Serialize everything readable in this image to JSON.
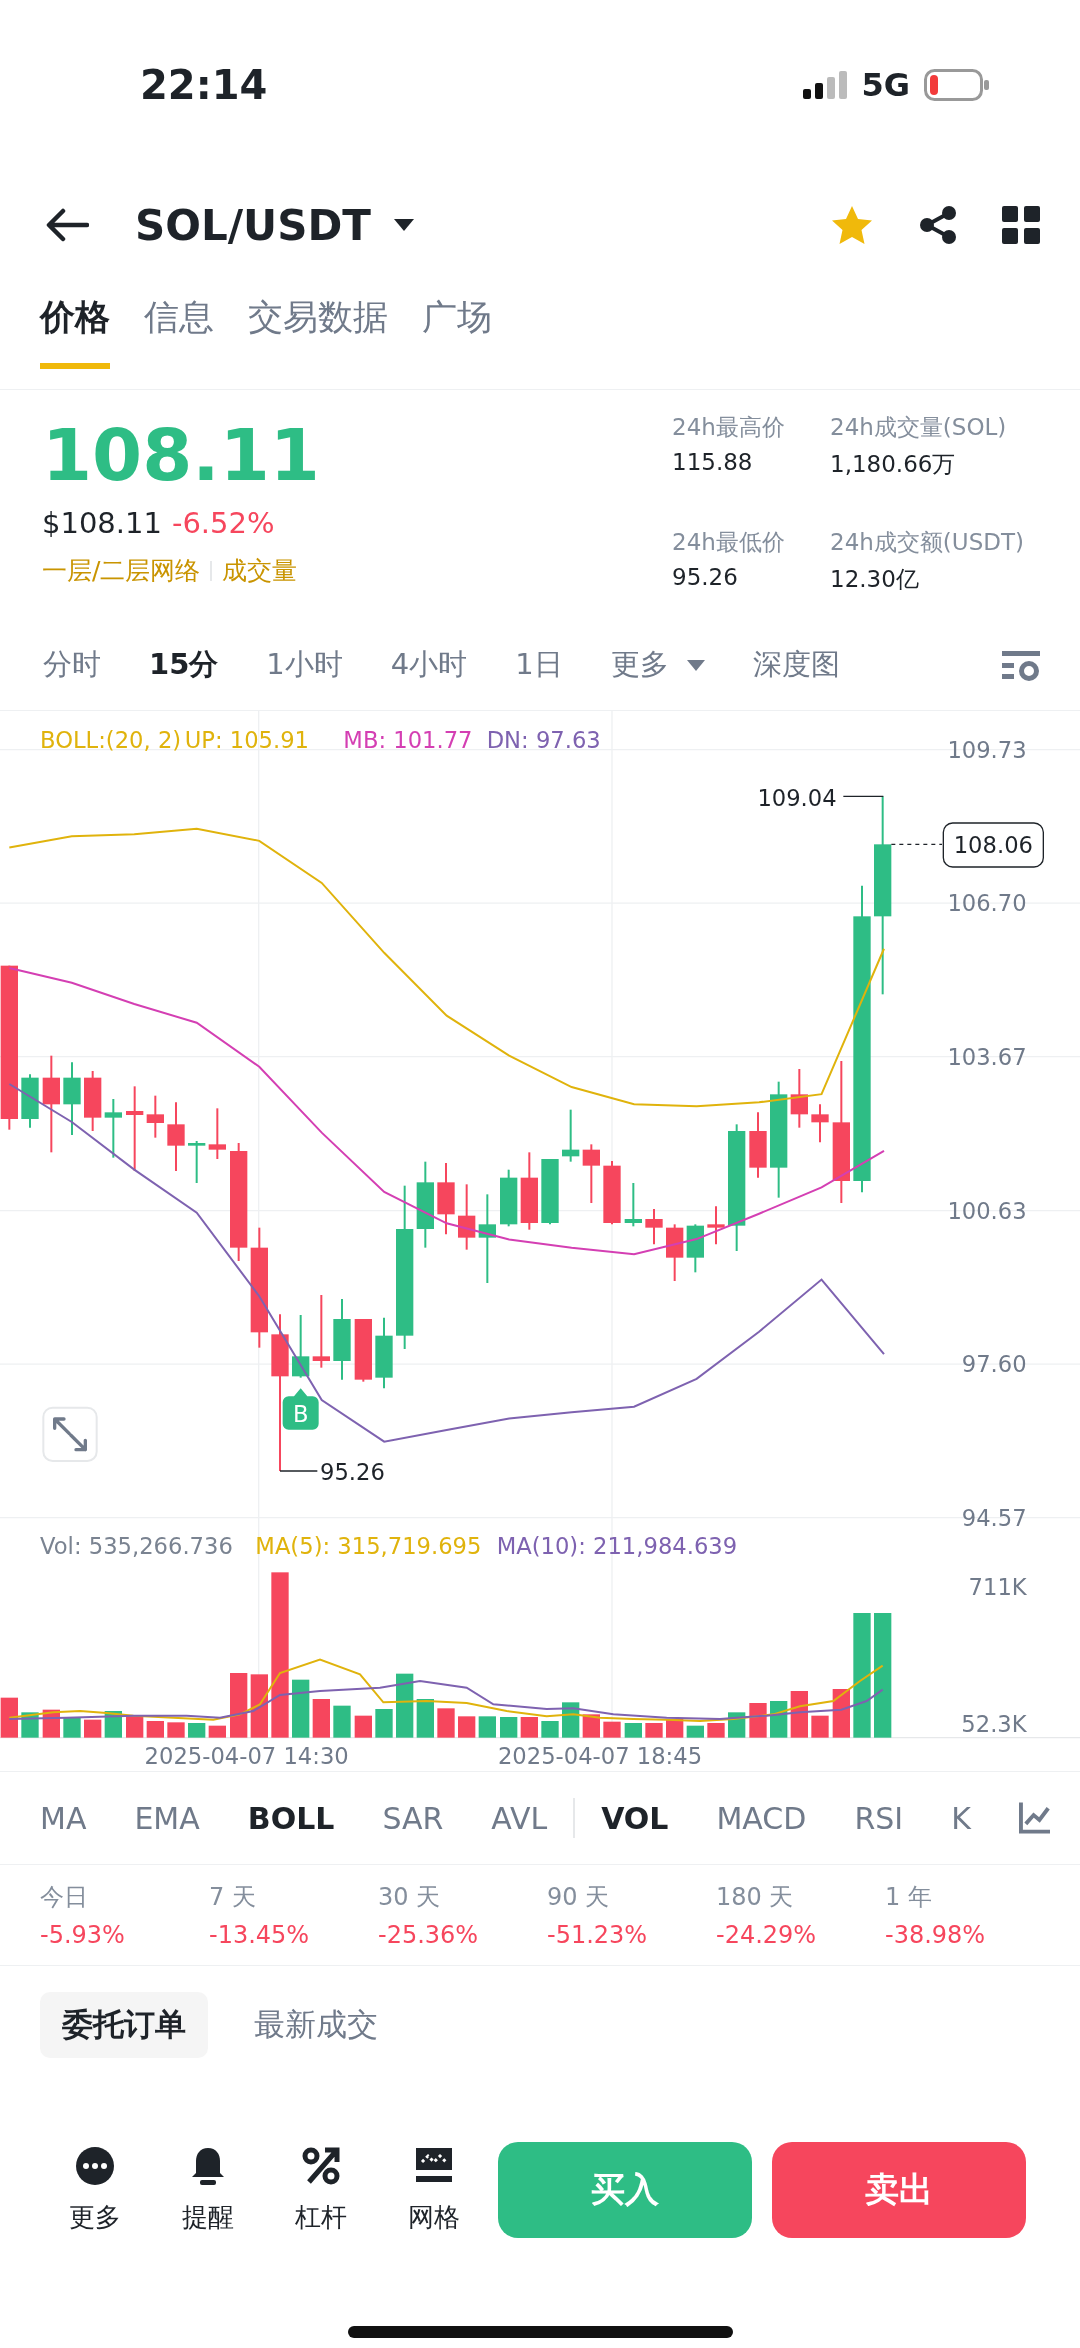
{
  "status_bar": {
    "time": "22:14",
    "network": "5G"
  },
  "header": {
    "title": "SOL/USDT",
    "favorite": true
  },
  "tabs": [
    {
      "label": "价格",
      "selected": true
    },
    {
      "label": "信息",
      "selected": false
    },
    {
      "label": "交易数据",
      "selected": false
    },
    {
      "label": "广场",
      "selected": false
    }
  ],
  "price": {
    "last": "108.11",
    "usd": "$108.11",
    "change": "-6.52%",
    "tags": [
      "一层/二层网络",
      "成交量"
    ]
  },
  "stats": [
    {
      "label": "24h最高价",
      "value": "115.88"
    },
    {
      "label": "24h成交量(SOL)",
      "value": "1,180.66万"
    },
    {
      "label": "24h最低价",
      "value": "95.26"
    },
    {
      "label": "24h成交额(USDT)",
      "value": "12.30亿"
    }
  ],
  "intervals": [
    {
      "label": "分时",
      "kind": "option",
      "selected": false
    },
    {
      "label": "15分",
      "kind": "option",
      "selected": true
    },
    {
      "label": "1小时",
      "kind": "option",
      "selected": false
    },
    {
      "label": "4小时",
      "kind": "option",
      "selected": false
    },
    {
      "label": "1日",
      "kind": "option",
      "selected": false
    },
    {
      "label": "更多",
      "kind": "dropdown",
      "selected": false
    },
    {
      "label": "深度图",
      "kind": "option",
      "selected": false
    }
  ],
  "chart": {
    "legend": [
      {
        "text": "BOLL:(20, 2)",
        "color": "#e0b30c"
      },
      {
        "text": "UP: 105.91",
        "color": "#e0b30c"
      },
      {
        "text": "MB: 101.77",
        "color": "#d43fb3"
      },
      {
        "text": "DN: 97.63",
        "color": "#7e62b0"
      }
    ],
    "chart_data": {
      "type": "line",
      "ylim": [
        94.57,
        109.73
      ],
      "grid": true,
      "yticks": [
        {
          "value": 109.73,
          "label": "109.73"
        },
        {
          "value": 106.7,
          "label": "106.70"
        },
        {
          "value": 103.67,
          "label": "103.67"
        },
        {
          "value": 100.63,
          "label": "100.63"
        },
        {
          "value": 97.6,
          "label": "97.60"
        },
        {
          "value": 94.57,
          "label": "94.57"
        }
      ],
      "series": [
        {
          "color": "#e0b30c",
          "values": [
            107.8,
            108.02,
            108.06,
            108.17,
            107.93,
            107.1,
            105.72,
            104.48,
            103.69,
            103.07,
            102.73,
            102.69,
            102.77,
            102.93,
            105.8
          ]
        },
        {
          "color": "#d43fb3",
          "values": [
            105.42,
            105.13,
            104.71,
            104.34,
            103.47,
            102.17,
            101.0,
            100.38,
            100.06,
            99.9,
            99.77,
            100.07,
            100.57,
            101.09,
            101.81
          ]
        },
        {
          "color": "#7e62b0",
          "values": [
            103.13,
            102.38,
            101.44,
            100.59,
            98.94,
            96.89,
            96.07,
            96.3,
            96.53,
            96.65,
            96.76,
            97.31,
            98.24,
            99.27,
            97.8
          ]
        }
      ]
    },
    "high_label": "109.04",
    "low_label": "95.26",
    "current_price": "108.06",
    "marker": "B",
    "volume_legend": [
      {
        "text": "Vol: 535,266.736",
        "color": "#7a8391"
      },
      {
        "text": "MA(5): 315,719.695",
        "color": "#e0b30c"
      },
      {
        "text": "MA(10): 211,984.639",
        "color": "#7e62b0"
      }
    ],
    "volume_ticks": [
      "711K",
      "52.3K"
    ],
    "time_labels": [
      "2025-04-07 14:30",
      "2025-04-07 18:45"
    ]
  },
  "main_indicators": [
    {
      "label": "MA",
      "selected": false
    },
    {
      "label": "EMA",
      "selected": false
    },
    {
      "label": "BOLL",
      "selected": true
    },
    {
      "label": "SAR",
      "selected": false
    },
    {
      "label": "AVL",
      "selected": false
    }
  ],
  "sub_indicators": [
    {
      "label": "VOL",
      "selected": true
    },
    {
      "label": "MACD",
      "selected": false
    },
    {
      "label": "RSI",
      "selected": false
    },
    {
      "label": "K",
      "selected": false
    }
  ],
  "performance": [
    {
      "period": "今日",
      "change": "-5.93%"
    },
    {
      "period": "7 天",
      "change": "-13.45%"
    },
    {
      "period": "30 天",
      "change": "-25.36%"
    },
    {
      "period": "90 天",
      "change": "-51.23%"
    },
    {
      "period": "180 天",
      "change": "-24.29%"
    },
    {
      "period": "1 年",
      "change": "-38.98%"
    }
  ],
  "order_tabs": [
    {
      "label": "委托订单",
      "selected": true
    },
    {
      "label": "最新成交",
      "selected": false
    }
  ],
  "actions": [
    {
      "label": "更多",
      "kind": "more"
    },
    {
      "label": "提醒",
      "kind": "alert"
    },
    {
      "label": "杠杆",
      "kind": "margin"
    },
    {
      "label": "网格",
      "kind": "grid"
    }
  ],
  "trade_buttons": [
    {
      "label": "买入",
      "kind": "buy"
    },
    {
      "label": "卖出",
      "kind": "sell"
    }
  ]
}
